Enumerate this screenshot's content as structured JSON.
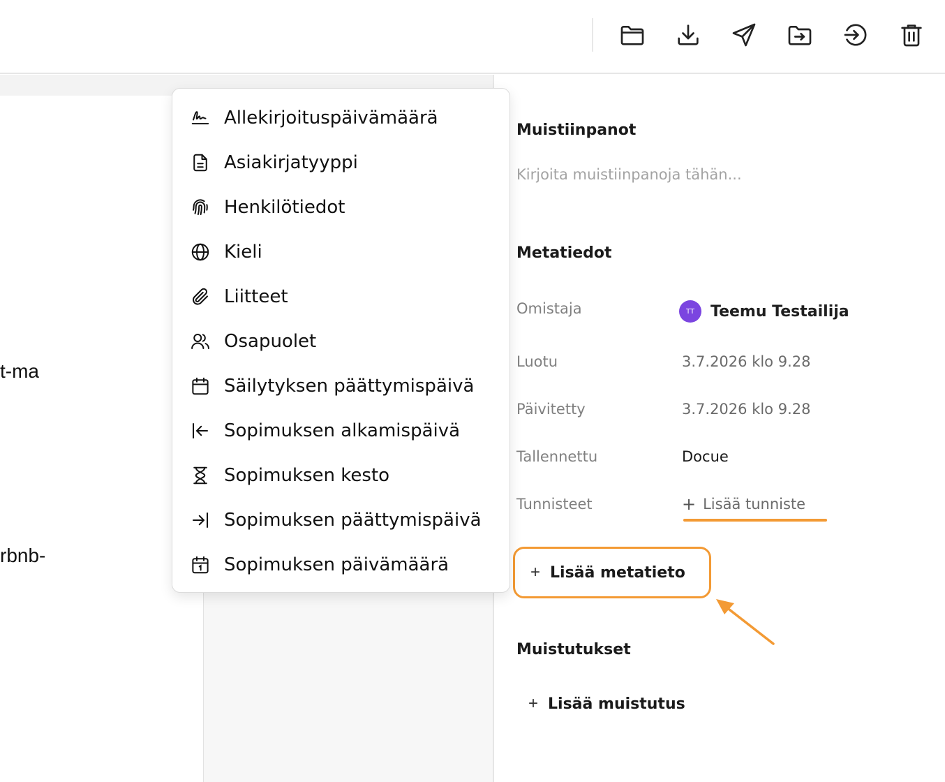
{
  "document": {
    "visible_fragments": [
      "t-ma",
      "rbnb-"
    ]
  },
  "toolbar": {
    "icons": [
      "folder-icon",
      "download-icon",
      "send-icon",
      "move-to-folder-icon",
      "sign-in-icon",
      "trash-icon"
    ]
  },
  "dropdown": {
    "items": [
      {
        "label": "Allekirjoituspäivämäärä",
        "icon": "signature-icon"
      },
      {
        "label": "Asiakirjatyyppi",
        "icon": "document-icon"
      },
      {
        "label": "Henkilötiedot",
        "icon": "fingerprint-icon"
      },
      {
        "label": "Kieli",
        "icon": "globe-icon"
      },
      {
        "label": "Liitteet",
        "icon": "paperclip-icon"
      },
      {
        "label": "Osapuolet",
        "icon": "users-icon"
      },
      {
        "label": "Säilytyksen päättymispäivä",
        "icon": "calendar-icon"
      },
      {
        "label": "Sopimuksen alkamispäivä",
        "icon": "arrow-left-to-line-icon"
      },
      {
        "label": "Sopimuksen kesto",
        "icon": "hourglass-icon"
      },
      {
        "label": "Sopimuksen päättymispäivä",
        "icon": "arrow-right-to-line-icon"
      },
      {
        "label": "Sopimuksen päivämäärä",
        "icon": "calendar-day-icon"
      }
    ]
  },
  "panel": {
    "notes_title": "Muistiinpanot",
    "notes_placeholder": "Kirjoita muistiinpanoja tähän...",
    "metadata_title": "Metatiedot",
    "owner_label": "Omistaja",
    "owner_initials": "TT",
    "owner_name": "Teemu Testailija",
    "created_label": "Luotu",
    "created_value": "3.7.2026 klo 9.28",
    "updated_label": "Päivitetty",
    "updated_value": "3.7.2026 klo 9.28",
    "saved_label": "Tallennettu",
    "saved_value": "Docue",
    "tags_label": "Tunnisteet",
    "add_tag_label": "Lisää tunniste",
    "add_metadata_label": "Lisää metatieto",
    "reminders_title": "Muistutukset",
    "add_reminder_label": "Lisää muistutus"
  },
  "colors": {
    "highlight": "#f39a34",
    "avatar": "#7b45e0"
  }
}
